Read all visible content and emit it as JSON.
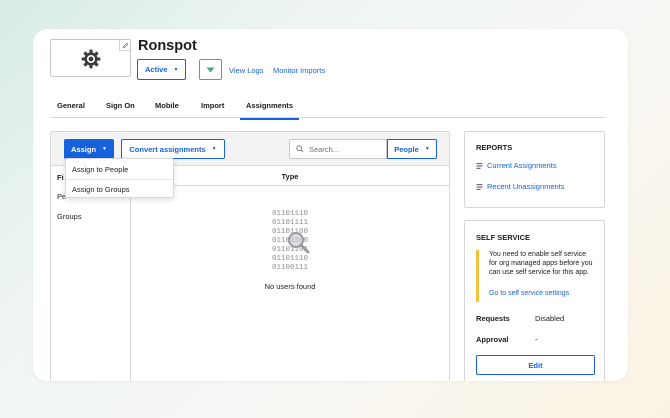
{
  "app": {
    "title": "Ronspot",
    "status": "Active",
    "links": [
      "View Logs",
      "Monitor Imports"
    ]
  },
  "tabs": [
    {
      "label": "General",
      "active": false
    },
    {
      "label": "Sign On",
      "active": false
    },
    {
      "label": "Mobile",
      "active": false
    },
    {
      "label": "Import",
      "active": false
    },
    {
      "label": "Assignments",
      "active": true
    }
  ],
  "toolbar": {
    "assign_label": "Assign",
    "convert_label": "Convert assignments",
    "search_placeholder": "Search...",
    "people_label": "People"
  },
  "assign_menu": [
    "Assign to People",
    "Assign to Groups"
  ],
  "filters": {
    "header": "Fi",
    "items": [
      "Pe",
      "Groups"
    ]
  },
  "table": {
    "type_header": "Type",
    "empty_binary": [
      "01101110",
      "01101111",
      "01101100",
      "01101100",
      "01101101",
      "01101110",
      "01100111"
    ],
    "empty_message": "No users found"
  },
  "reports": {
    "title": "REPORTS",
    "links": [
      "Current Assignments",
      "Recent Unassignments"
    ]
  },
  "self_service": {
    "title": "SELF SERVICE",
    "notice": "You need to enable self service for org managed apps before you can use self service for this app.",
    "notice_link": "Go to self service settings",
    "requests_label": "Requests",
    "requests_value": "Disabled",
    "approval_label": "Approval",
    "approval_value": "-",
    "edit_label": "Edit"
  },
  "colors": {
    "accent": "#1662dd",
    "success": "#45b06b",
    "warning": "#f5c33b"
  }
}
